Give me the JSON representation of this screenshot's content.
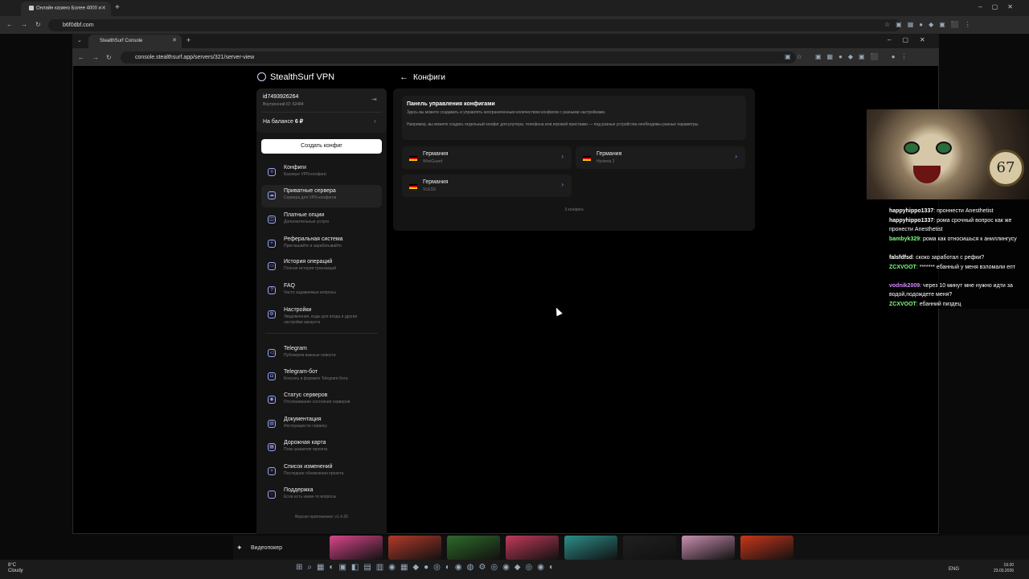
{
  "outer_browser": {
    "tab_title": "Онлайн казино Более 4000 и",
    "url": "b6f0dbf.com"
  },
  "inner_browser": {
    "tab_title": "StealthSurf Console",
    "url": "console.stealthsurf.app/servers/321/server-view"
  },
  "app": {
    "brand": "StealthSurf VPN",
    "account": {
      "id": "id7493926264",
      "internal_id": "Внутренний ID: 62484",
      "balance_label": "На балансе",
      "balance_value": "6 ₽"
    },
    "create_button": "Создать конфиг",
    "menu": [
      {
        "title": "Конфиги",
        "sub": "Базовые VPN-конфиги",
        "icon": "list-icon"
      },
      {
        "title": "Приватные сервера",
        "sub": "Сервера для VPN-конфигов",
        "icon": "cloud-icon"
      },
      {
        "title": "Платные опции",
        "sub": "Дополнительные услуги",
        "icon": "layers-icon"
      },
      {
        "title": "Реферальная система",
        "sub": "Приглашайте и зарабатывайте",
        "icon": "user-plus-icon"
      },
      {
        "title": "История операций",
        "sub": "Полная история транзакций",
        "icon": "card-icon"
      },
      {
        "title": "FAQ",
        "sub": "Часто задаваемые вопросы",
        "icon": "chat-icon"
      },
      {
        "title": "Настройки",
        "sub": "Уведомления, коды для входа и другие настройки аккаунта",
        "icon": "gear-icon"
      },
      {
        "title": "Telegram",
        "sub": "Публикуем важные новости",
        "icon": "megaphone-icon"
      },
      {
        "title": "Telegram-бот",
        "sub": "Консоль в формате Telegram-бота",
        "icon": "bot-icon"
      },
      {
        "title": "Статус серверов",
        "sub": "Отслеживание состояния серверов",
        "icon": "signal-icon"
      },
      {
        "title": "Документация",
        "sub": "Инструкции по сервису",
        "icon": "doc-icon"
      },
      {
        "title": "Дорожная карта",
        "sub": "План развития проекта",
        "icon": "map-icon"
      },
      {
        "title": "Список изменений",
        "sub": "Последние обновления проекта",
        "icon": "sparkle-icon"
      },
      {
        "title": "Поддержка",
        "sub": "Если есть какие-то вопросы",
        "icon": "support-icon"
      }
    ],
    "version": "Версия приложения: v1.4.26",
    "page_title": "Конфиги",
    "info": {
      "title": "Панель управления конфигами",
      "line1": "Здесь вы можете создавать и управлять неограниченным количеством конфигов с разными настройками.",
      "line2": "Например, вы можете создать отдельный конфиг для роутера, телефона или игровой приставки — под разные устройства необходимы разные параметры."
    },
    "configs": [
      {
        "country": "Германия",
        "protocol": "WireGuard"
      },
      {
        "country": "Германия",
        "protocol": "Hysteria 2"
      },
      {
        "country": "Германия",
        "protocol": "VLESS"
      }
    ],
    "count_text": "3 конфига"
  },
  "stream_overlay": {
    "clock_number": "67",
    "chat": [
      {
        "user": "happyhippo1337",
        "color": "#ffffff",
        "text": "проннести Anesthetist"
      },
      {
        "user": "happyhippo1337",
        "color": "#ffffff",
        "text": "рома срочный вопрос как же пронести Anesthetist"
      },
      {
        "user": "bambyk329",
        "color": "#7dff7d",
        "text": "рома как относишься к аниллингусу"
      },
      {
        "user": "falsfdfsd",
        "color": "#ffffff",
        "text": "скоко заработал с рефки?"
      },
      {
        "user": "ZCXVOOT",
        "color": "#7dff7d",
        "text": "******* ебанный у меня взломали епт"
      },
      {
        "user": "vodnik2009",
        "color": "#d78bff",
        "text": "через 10 минут мне нужно идти за водой,подождете меня?"
      },
      {
        "user": "ZCXVOOT",
        "color": "#7dff7d",
        "text": "ебанний пиздец"
      }
    ]
  },
  "bottom": {
    "games_label": "Видеопокер",
    "game_colors": [
      "#d9468a",
      "#b33a2a",
      "#2e6b2a",
      "#c23a5a",
      "#2c8f8a",
      "#202020",
      "#c98fb0",
      "#c9361a"
    ],
    "weather_temp": "8°C",
    "weather_desc": "Cloudy",
    "lang": "ENG",
    "time": "19:20",
    "date": "23.03.2026"
  }
}
